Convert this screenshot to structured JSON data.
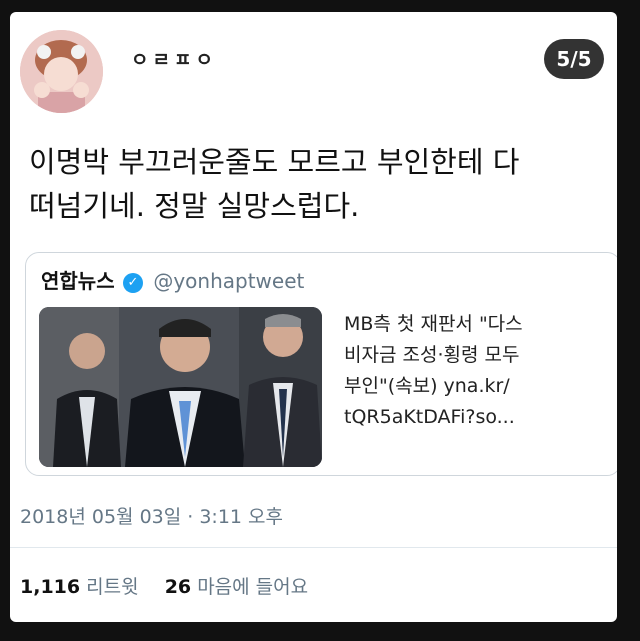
{
  "profile": {
    "username": "ㅇㄹㅍㅇ",
    "page_badge": "5/5"
  },
  "tweet": {
    "text_line1": "이명박 부끄러운줄도 모르고 부인한테 다",
    "text_line2": "떠넘기네. 정말 실망스럽다."
  },
  "quote": {
    "author": "연합뉴스",
    "verified_mark": "✓",
    "handle": "@yonhaptweet",
    "text_line1": "MB측 첫 재판서 \"다스",
    "text_line2": "비자금 조성·횡령 모두",
    "text_line3": "부인\"(속보) yna.kr/",
    "text_line4": "tQR5aKtDAFi?so..."
  },
  "meta": {
    "timestamp": "2018년 05월 03일 · 3:11 오후",
    "retweet_count": "1,116",
    "retweet_label": "리트윗",
    "like_count": "26",
    "like_label": "마음에 들어요"
  },
  "icons": {
    "avatar": "avatar-photo",
    "verified": "verified-badge-icon"
  },
  "colors": {
    "verified": "#1da1f2",
    "meta_text": "#657786",
    "badge_bg": "#333333"
  }
}
